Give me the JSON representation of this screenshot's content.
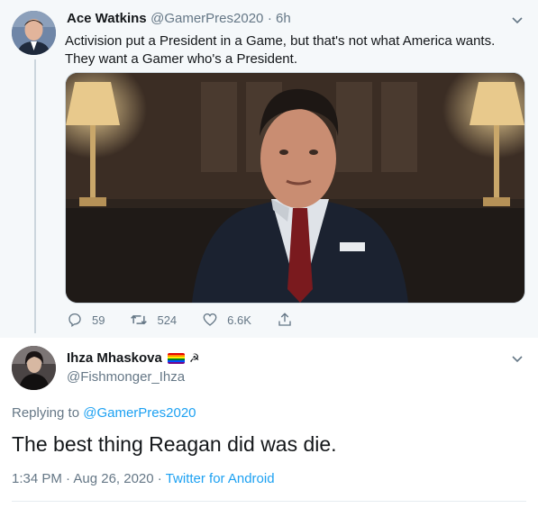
{
  "tweet": {
    "author_name": "Ace Watkins",
    "handle": "@GamerPres2020",
    "time": "· 6h",
    "text": "Activision put a President in a Game, but that's not what America wants. They want a Gamer who's a President.",
    "actions": {
      "replies": "59",
      "retweets": "524",
      "likes": "6.6K"
    }
  },
  "reply": {
    "author_name": "Ihza Mhaskova",
    "handle": "@Fishmonger_Ihza",
    "replying_prefix": "Replying to",
    "replying_to": "@GamerPres2020",
    "text": "The best thing Reagan did was die.",
    "timestamp": "1:34 PM · Aug 26, 2020 ·",
    "source": "Twitter for Android"
  },
  "icons": {
    "reply": "reply-icon",
    "retweet": "retweet-icon",
    "like": "heart-icon",
    "share": "share-icon",
    "more": "chevron-down-icon",
    "flag": "rainbow-flag-icon",
    "hammer": "hammer-sickle-icon"
  },
  "colors": {
    "accent": "#1da1f2",
    "muted": "#657786",
    "thread_bg": "#f5f8fa"
  }
}
